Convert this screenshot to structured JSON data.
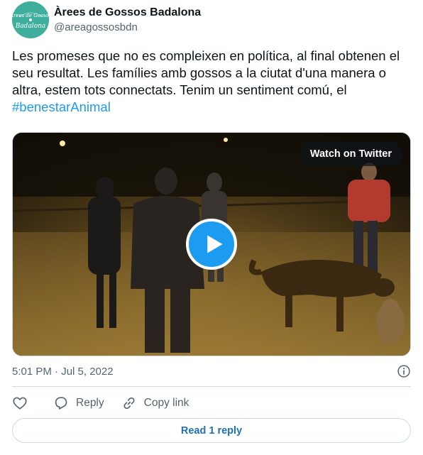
{
  "author": {
    "display_name": "Àrees de Gossos Badalona",
    "handle": "@areagossosbdn",
    "avatar_color": "#3fae9c",
    "avatar_text_top": "Àrees de Gossos",
    "avatar_text_bottom": "Badalona"
  },
  "tweet": {
    "text": "Les promeses que no es compleixen en política, al final obtenen el seu resultat. Les famílies amb gossos a la ciutat d'una manera o altra, estem tots connectats. Tenim un sentiment comú, el ",
    "hashtag": "#benestarAnimal",
    "hashtag_color": "#1d9bf0"
  },
  "media": {
    "watch_label": "Watch on Twitter",
    "play_icon": "play-icon",
    "accent": "#1d9bf0"
  },
  "meta": {
    "timestamp": "5:01 PM · Jul 5, 2022",
    "info_icon": "info-icon"
  },
  "actions": {
    "like_icon": "heart-icon",
    "reply_label": "Reply",
    "reply_icon": "reply-icon",
    "copy_label": "Copy link",
    "copy_icon": "link-icon"
  },
  "footer": {
    "read_replies_label": "Read 1 reply"
  }
}
